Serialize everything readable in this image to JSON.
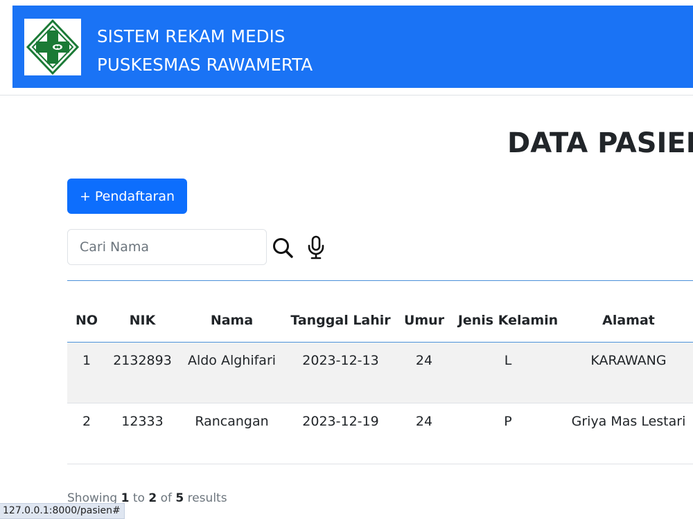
{
  "header": {
    "logo_icon": "puskesmas-cross-logo",
    "brand_line1": "SISTEM REKAM MEDIS",
    "brand_line2": "PUSKESMAS RAWAMERTA",
    "accent_color": "#1a73f5"
  },
  "main": {
    "title": "DATA PASIEN",
    "add_button_label": "+ Pendaftaran",
    "search": {
      "placeholder": "Cari Nama",
      "value": "",
      "search_icon": "search-icon",
      "mic_icon": "microphone-icon"
    },
    "table": {
      "headers": [
        "NO",
        "NIK",
        "Nama",
        "Tanggal Lahir",
        "Umur",
        "Jenis Kelamin",
        "Alamat"
      ],
      "rows": [
        [
          "1",
          "2132893",
          "Aldo Alghifari",
          "2023-12-13",
          "24",
          "L",
          "KARAWANG"
        ],
        [
          "2",
          "12333",
          "Rancangan",
          "2023-12-19",
          "24",
          "P",
          "Griya Mas Lestari"
        ]
      ]
    },
    "pagination": {
      "showing": "Showing",
      "from": "1",
      "to_word": "to",
      "to": "2",
      "of_word": "of",
      "total": "5",
      "results": "results"
    }
  },
  "status_bar": {
    "url": "127.0.0.1:8000/pasien#"
  }
}
